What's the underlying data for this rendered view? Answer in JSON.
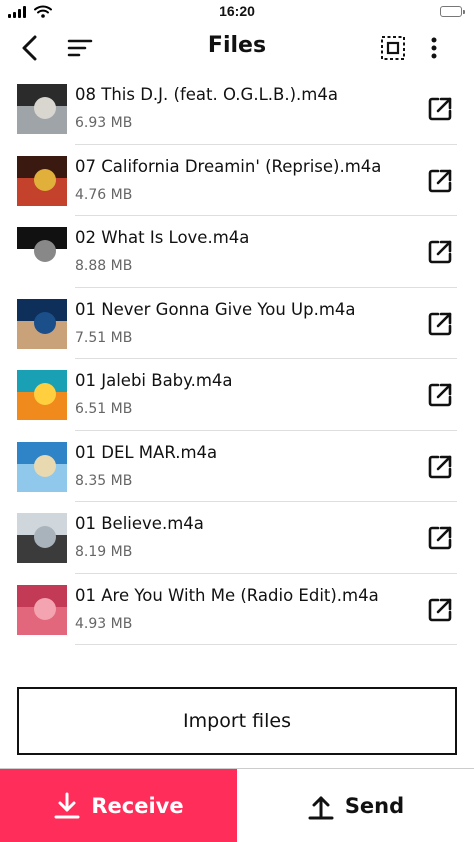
{
  "status_bar": {
    "time": "16:20"
  },
  "header": {
    "title": "Files",
    "back_icon": "chevron-left-icon",
    "sort_icon": "sort-lines-icon",
    "select_icon": "select-all-icon",
    "more_icon": "more-vertical-icon"
  },
  "files": [
    {
      "name": "08 This D.J. (feat. O.G.L.B.).m4a",
      "size": "6.93 MB",
      "thumb_colors": [
        "#2b2b2b",
        "#9fa4a8",
        "#d8d6cf"
      ]
    },
    {
      "name": "07 California Dreamin' (Reprise).m4a",
      "size": "4.76 MB",
      "thumb_colors": [
        "#3a1a10",
        "#c4412c",
        "#e0b03a"
      ]
    },
    {
      "name": "02 What Is Love.m4a",
      "size": "8.88 MB",
      "thumb_colors": [
        "#111111",
        "#ffffff",
        "#888888"
      ]
    },
    {
      "name": "01 Never Gonna Give You Up.m4a",
      "size": "7.51 MB",
      "thumb_colors": [
        "#0d2f5a",
        "#c9a27a",
        "#1b4f8a"
      ]
    },
    {
      "name": "01 Jalebi Baby.m4a",
      "size": "6.51 MB",
      "thumb_colors": [
        "#1aa0b4",
        "#f08a1c",
        "#ffcf3f"
      ]
    },
    {
      "name": "01 DEL MAR.m4a",
      "size": "8.35 MB",
      "thumb_colors": [
        "#2f83c7",
        "#8fc8ea",
        "#e8d9b0"
      ]
    },
    {
      "name": "01 Believe.m4a",
      "size": "8.19 MB",
      "thumb_colors": [
        "#cfd6dc",
        "#3b3b3b",
        "#a9b3bb"
      ]
    },
    {
      "name": "01 Are You With Me (Radio Edit).m4a",
      "size": "4.93 MB",
      "thumb_colors": [
        "#c23a56",
        "#e2667c",
        "#f4a3b0"
      ]
    }
  ],
  "import_button": {
    "label": "Import files"
  },
  "bottom_bar": {
    "receive_label": "Receive",
    "send_label": "Send",
    "receive_color": "#ff2d5a"
  }
}
